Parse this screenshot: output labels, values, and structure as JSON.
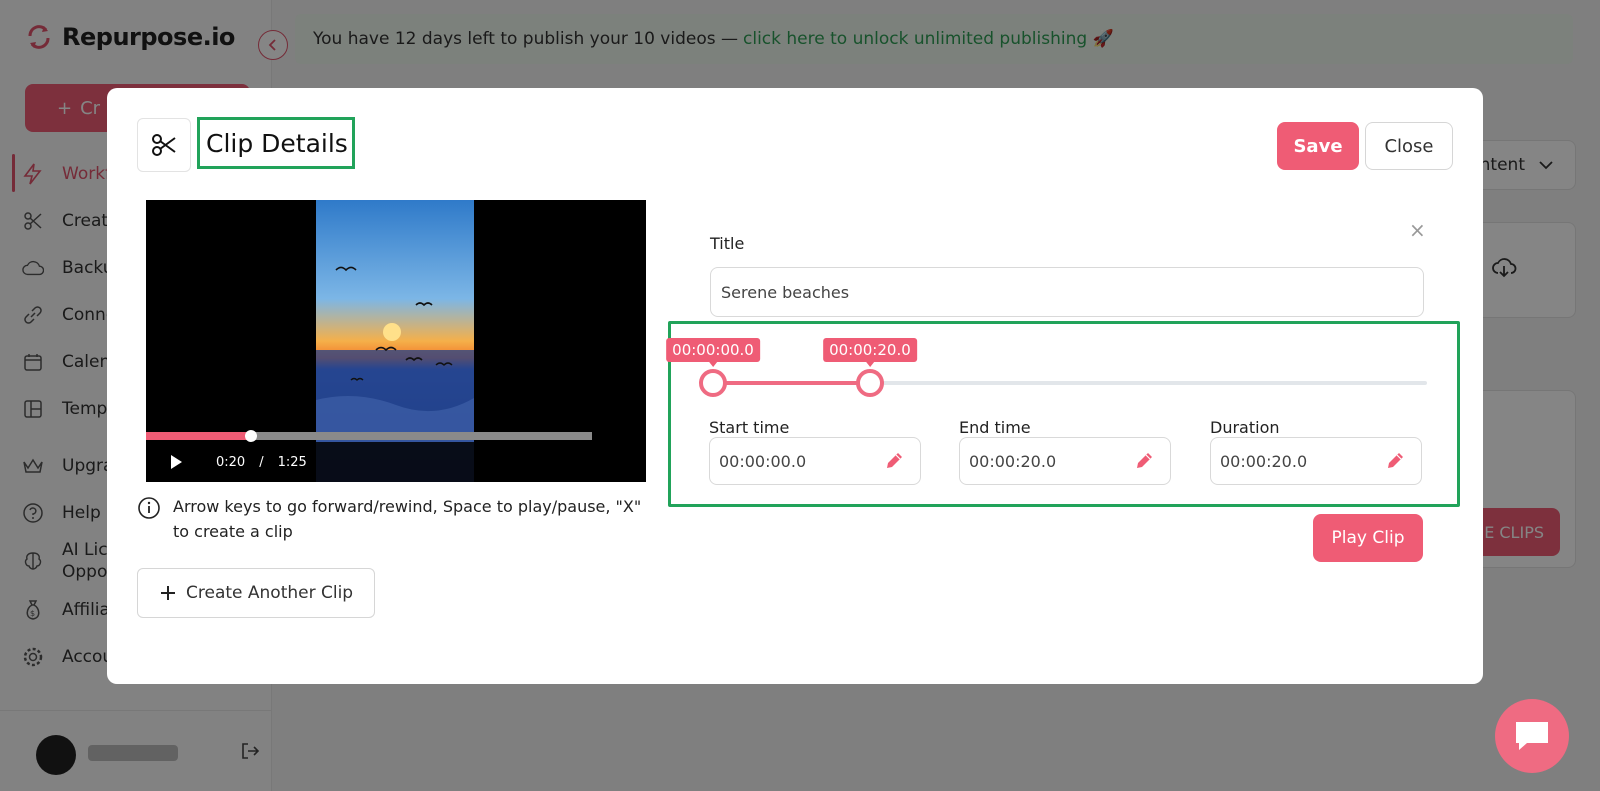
{
  "app": {
    "logo_text": "Repurpose.io",
    "create_label": "Cr",
    "nav": [
      {
        "label": "Workf",
        "icon": "lightning-icon"
      },
      {
        "label": "Create",
        "icon": "scissors-icon"
      },
      {
        "label": "Backu",
        "icon": "cloud-icon"
      },
      {
        "label": "Conne",
        "icon": "link-icon"
      },
      {
        "label": "Calen",
        "icon": "calendar-icon"
      },
      {
        "label": "Temp",
        "icon": "template-icon"
      },
      {
        "label": "Upgra",
        "icon": "crown-icon"
      },
      {
        "label": "Help &",
        "icon": "help-icon"
      },
      {
        "label": "AI Lice\nOppo",
        "icon": "brain-icon"
      },
      {
        "label": "Affilia",
        "icon": "money-bag-icon"
      },
      {
        "label": "Accou",
        "icon": "gear-icon"
      }
    ]
  },
  "banner": {
    "text": "You have 12 days left to publish your 10 videos —",
    "link": "click here to unlock unlimited publishing 🚀"
  },
  "background": {
    "dropdown_label": "ntent",
    "card_dots": "...",
    "clips_button": "E CLIPS"
  },
  "modal": {
    "title": "Clip Details",
    "save_label": "Save",
    "close_label": "Close",
    "video": {
      "current_time": "0:20",
      "separator": "/",
      "duration": "1:25",
      "progress": 0.235
    },
    "hint": "Arrow keys to go forward/rewind, Space to play/pause, \"X\" to create a clip",
    "create_another_label": "Create Another Clip",
    "close_x": "×",
    "form": {
      "title_label": "Title",
      "title_value": "Serene beaches",
      "range": {
        "start": 0.0,
        "end": 20.0,
        "total": 91.0,
        "start_tip": "00:00:00.0",
        "end_tip": "00:00:20.0"
      },
      "start_label": "Start time",
      "start_value": "00:00:00.0",
      "end_label": "End time",
      "end_value": "00:00:20.0",
      "duration_label": "Duration",
      "duration_value": "00:00:20.0"
    },
    "play_clip_label": "Play Clip"
  },
  "colors": {
    "accent": "#ef5c75",
    "highlight": "#21a35a"
  }
}
